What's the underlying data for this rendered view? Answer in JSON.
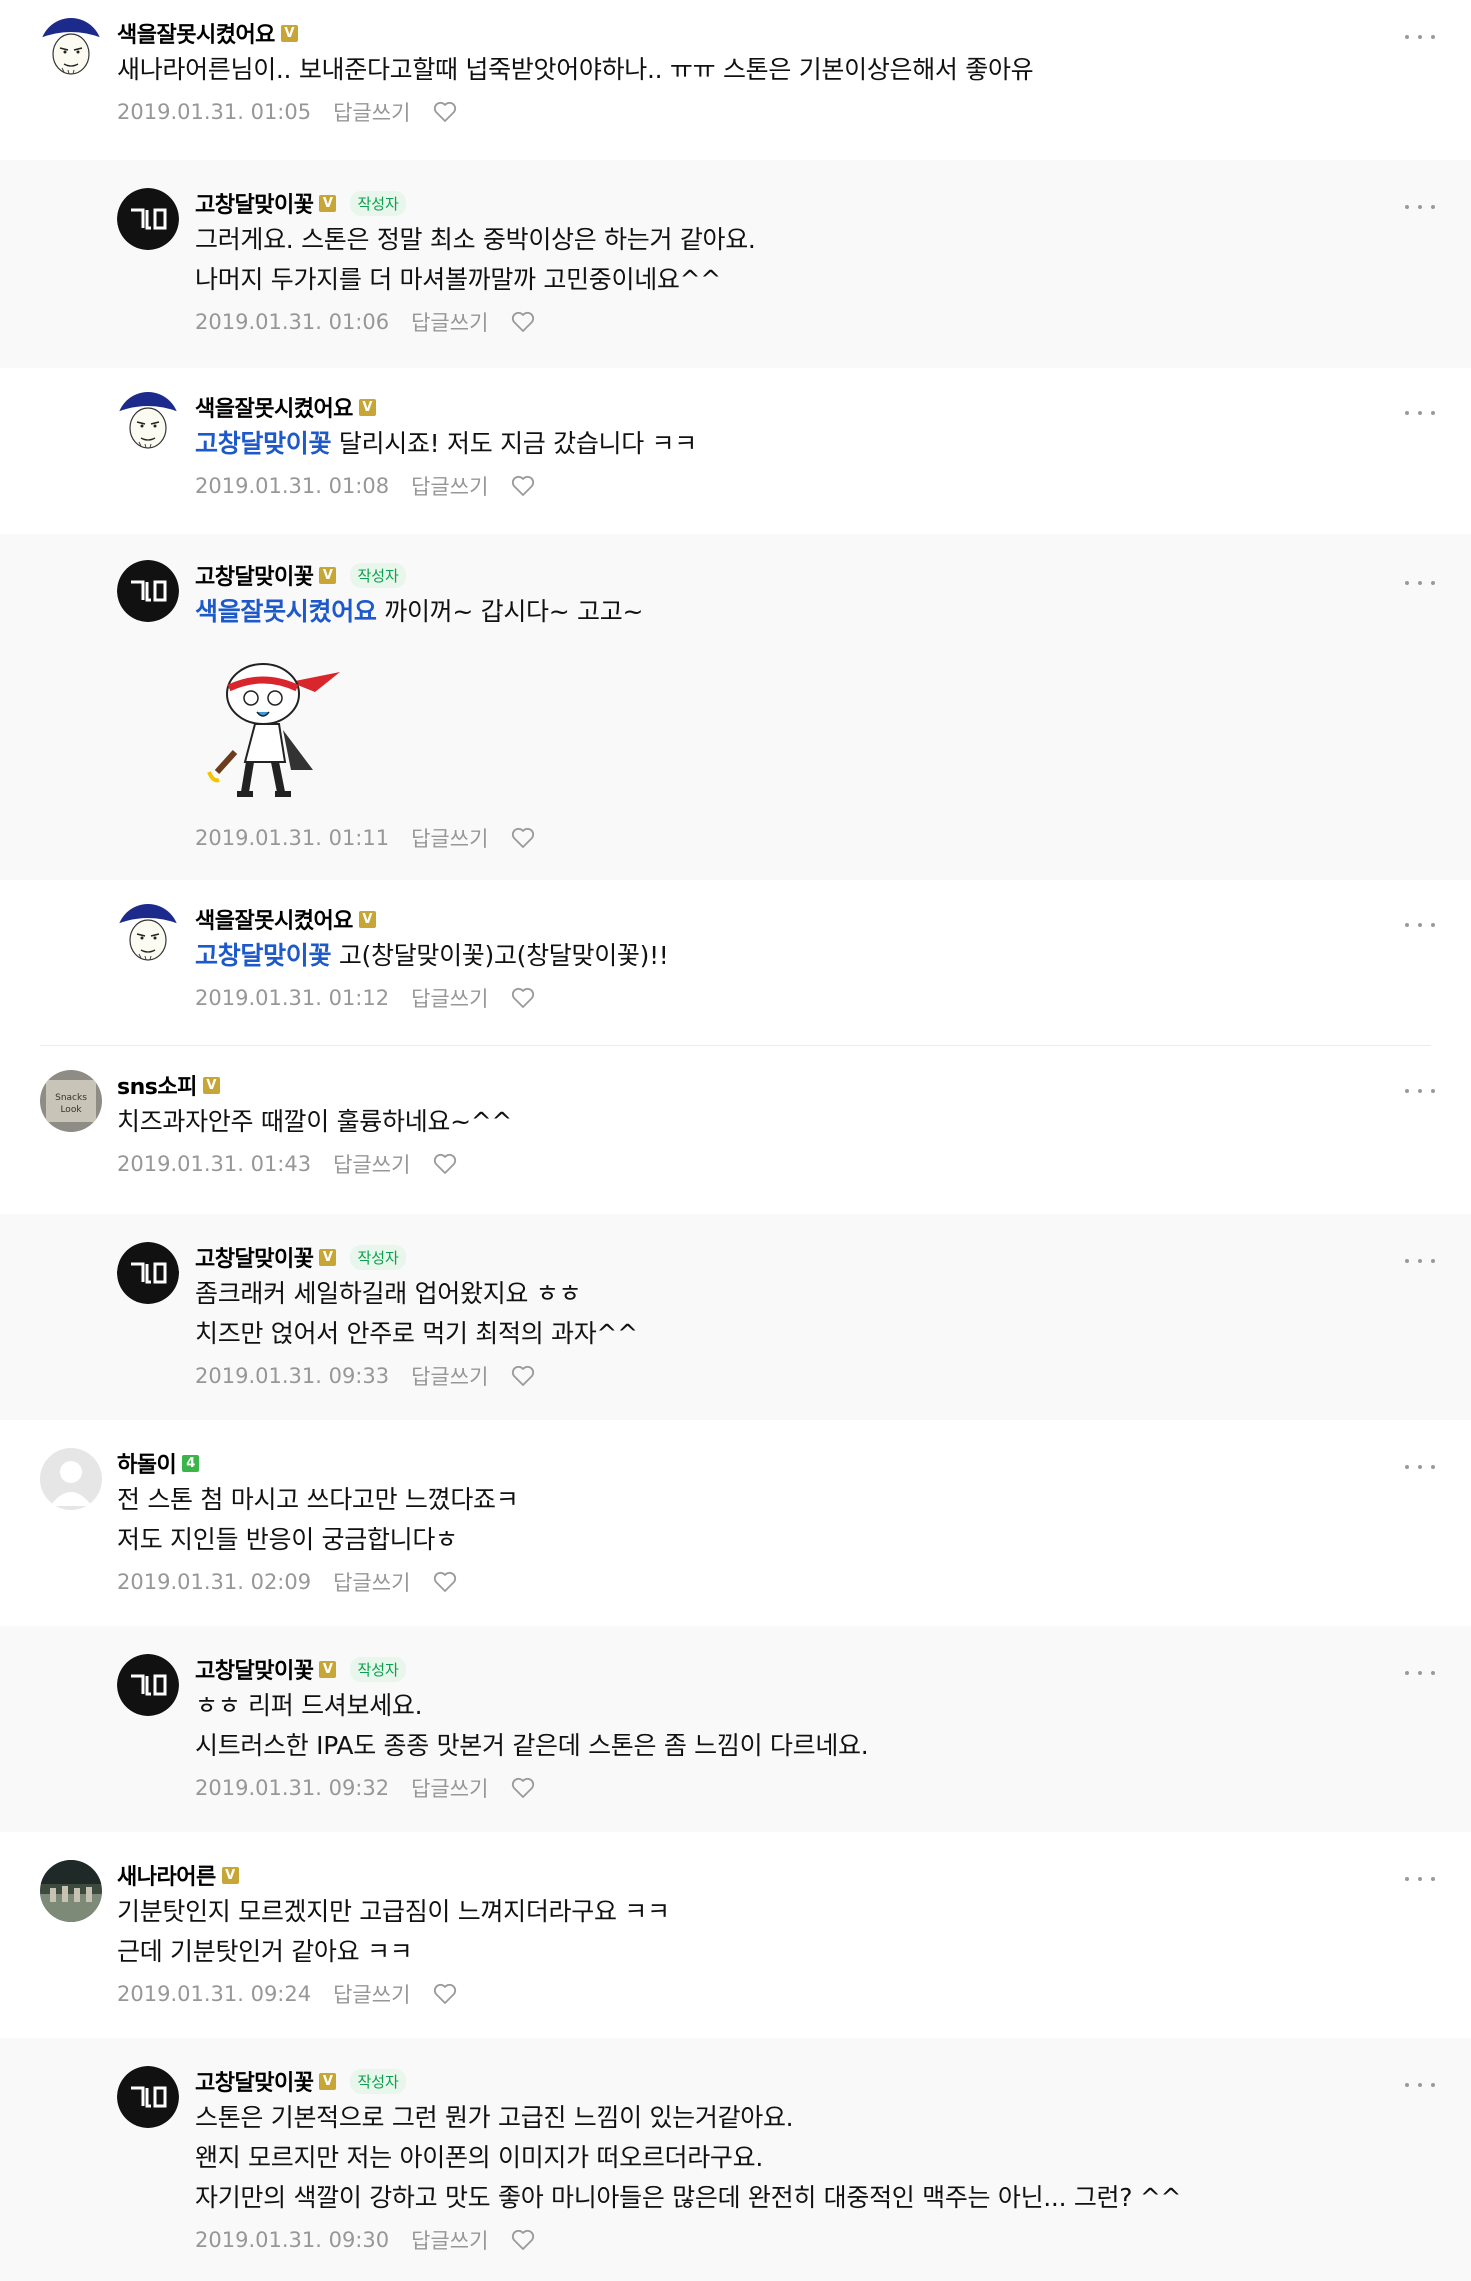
{
  "labels": {
    "reply": "답글쓰기",
    "author": "작성자"
  },
  "colors": {
    "mention": "#1d59c9",
    "badge_gold": "#c7a636",
    "badge_green": "#3bb54a"
  },
  "comments": [
    {
      "nick": "색을잘못시켰어요",
      "badge": "V",
      "text": "새나라어른님이.. 보내준다고할때 넙죽받앗어야하나.. ㅠㅠ 스톤은 기본이상은해서 좋아유",
      "date": "2019.01.31. 01:05"
    },
    {
      "nick": "고창달맞이꽃",
      "badge": "V",
      "text": "그러게요. 스톤은 정말 최소 중박이상은 하는거 같아요.\n나머지 두가지를 더 마셔볼까말까 고민중이네요^^",
      "date": "2019.01.31. 01:06"
    },
    {
      "nick": "색을잘못시켰어요",
      "badge": "V",
      "mention": "고창달맞이꽃",
      "text": " 달리시죠! 저도 지금 갔습니다 ㅋㅋ",
      "date": "2019.01.31. 01:08"
    },
    {
      "nick": "고창달맞이꽃",
      "badge": "V",
      "mention": "색을잘못시켰어요",
      "text": " 까이꺼~ 갑시다~ 고고~",
      "sticker": "running-character-sticker",
      "date": "2019.01.31. 01:11"
    },
    {
      "nick": "색을잘못시켰어요",
      "badge": "V",
      "mention": "고창달맞이꽃",
      "text": " 고(창달맞이꽃)고(창달맞이꽃)!!",
      "date": "2019.01.31. 01:12"
    },
    {
      "nick": "sns소피",
      "badge": "V",
      "text": "치즈과자안주 때깔이 훌륭하네요~^^",
      "date": "2019.01.31. 01:43"
    },
    {
      "nick": "고창달맞이꽃",
      "badge": "V",
      "text": "좀크래커 세일하길래 업어왔지요 ㅎㅎ\n치즈만 얹어서 안주로 먹기 최적의 과자^^",
      "date": "2019.01.31. 09:33"
    },
    {
      "nick": "하돌이",
      "badge": "4",
      "text": "전 스톤 첨 마시고 쓰다고만 느꼈다죠ㅋ\n저도 지인들 반응이 궁금합니다ㅎ",
      "date": "2019.01.31. 02:09"
    },
    {
      "nick": "고창달맞이꽃",
      "badge": "V",
      "text": "ㅎㅎ 리퍼 드셔보세요.\n시트러스한 IPA도 종종 맛본거 같은데 스톤은 좀 느낌이 다르네요.",
      "date": "2019.01.31. 09:32"
    },
    {
      "nick": "새나라어른",
      "badge": "V",
      "text": "기분탓인지 모르겠지만 고급짐이 느껴지더라구요 ㅋㅋ\n근데 기분탓인거 같아요 ㅋㅋ",
      "date": "2019.01.31. 09:24"
    },
    {
      "nick": "고창달맞이꽃",
      "badge": "V",
      "text": "스톤은 기본적으로 그런 뭔가 고급진 느낌이 있는거같아요.\n왠지 모르지만 저는 아이폰의 이미지가 떠오르더라구요.\n자기만의 색깔이 강하고 맛도 좋아 마니아들은 많은데 완전히 대중적인 맥주는 아닌... 그런? ^^",
      "date": "2019.01.31. 09:30"
    }
  ]
}
